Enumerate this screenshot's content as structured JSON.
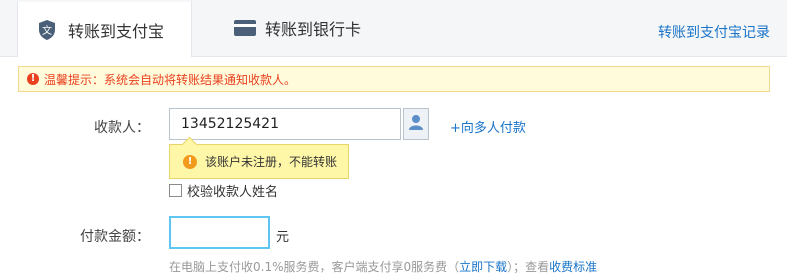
{
  "tabs": [
    {
      "label": "转账到支付宝",
      "icon": "alipay-shield-icon",
      "active": true
    },
    {
      "label": "转账到银行卡",
      "icon": "bank-card-icon",
      "active": false
    }
  ],
  "records_link": "转账到支付宝记录",
  "notice": {
    "title": "温馨提示：",
    "message": "系统会自动将转账结果通知收款人。"
  },
  "form": {
    "recipient_label": "收款人：",
    "recipient_value": "13452125421",
    "multi_pay_link": "+向多人付款",
    "error_tip": "该账户未注册，不能转账",
    "verify_name_label": "校验收款人姓名",
    "amount_label": "付款金额：",
    "amount_value": "",
    "currency_unit": "元",
    "fee_note_prefix": "在电脑上支付收0.1%服务费，客户端支付享0服务费（",
    "fee_note_link1": "立即下载",
    "fee_note_mid": "）；查看",
    "fee_note_link2": "收费标准"
  },
  "colors": {
    "link": "#1a74c8",
    "warning": "#e9401f",
    "focus_border": "#5fc6f2"
  }
}
